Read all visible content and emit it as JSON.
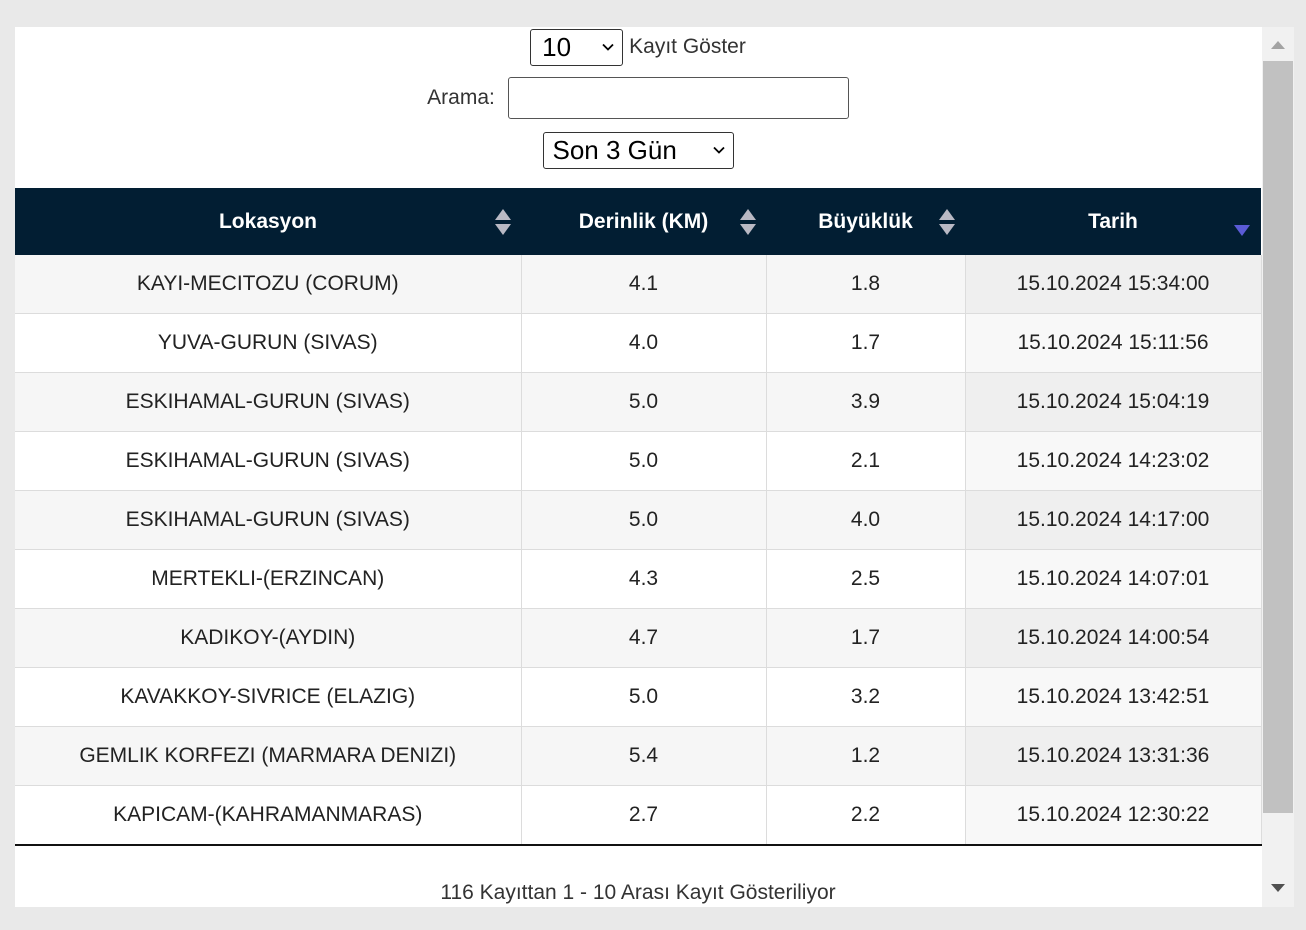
{
  "controls": {
    "length_value": "10",
    "length_label": "Kayıt Göster",
    "search_label": "Arama:",
    "search_value": "",
    "range_value": "Son 3 Gün"
  },
  "table": {
    "columns": [
      "Lokasyon",
      "Derinlik (KM)",
      "Büyüklük",
      "Tarih"
    ],
    "sorted_column": "Tarih",
    "sort_direction": "desc",
    "rows": [
      [
        "KAYI-MECITOZU (CORUM)",
        "4.1",
        "1.8",
        "15.10.2024 15:34:00"
      ],
      [
        "YUVA-GURUN (SIVAS)",
        "4.0",
        "1.7",
        "15.10.2024 15:11:56"
      ],
      [
        "ESKIHAMAL-GURUN (SIVAS)",
        "5.0",
        "3.9",
        "15.10.2024 15:04:19"
      ],
      [
        "ESKIHAMAL-GURUN (SIVAS)",
        "5.0",
        "2.1",
        "15.10.2024 14:23:02"
      ],
      [
        "ESKIHAMAL-GURUN (SIVAS)",
        "5.0",
        "4.0",
        "15.10.2024 14:17:00"
      ],
      [
        "MERTEKLI-(ERZINCAN)",
        "4.3",
        "2.5",
        "15.10.2024 14:07:01"
      ],
      [
        "KADIKOY-(AYDIN)",
        "4.7",
        "1.7",
        "15.10.2024 14:00:54"
      ],
      [
        "KAVAKKOY-SIVRICE (ELAZIG)",
        "5.0",
        "3.2",
        "15.10.2024 13:42:51"
      ],
      [
        "GEMLIK KORFEZI (MARMARA DENIZI)",
        "5.4",
        "1.2",
        "15.10.2024 13:31:36"
      ],
      [
        "KAPICAM-(KAHRAMANMARAS)",
        "2.7",
        "2.2",
        "15.10.2024 12:30:22"
      ]
    ]
  },
  "info_text": "116 Kayıttan 1 - 10 Arası Kayıt Gösteriliyor",
  "colors": {
    "header_bg": "#021e33",
    "header_text": "#ffffff",
    "sort_active": "#5b5bd6",
    "sort_inactive": "#b9b9c4"
  },
  "icons": {
    "select_arrow": "chevron-down-icon",
    "sort_both": "sort-both-icon",
    "sort_desc": "sort-desc-icon",
    "scroll_up": "scroll-up-arrow-icon",
    "scroll_down": "scroll-down-arrow-icon"
  }
}
